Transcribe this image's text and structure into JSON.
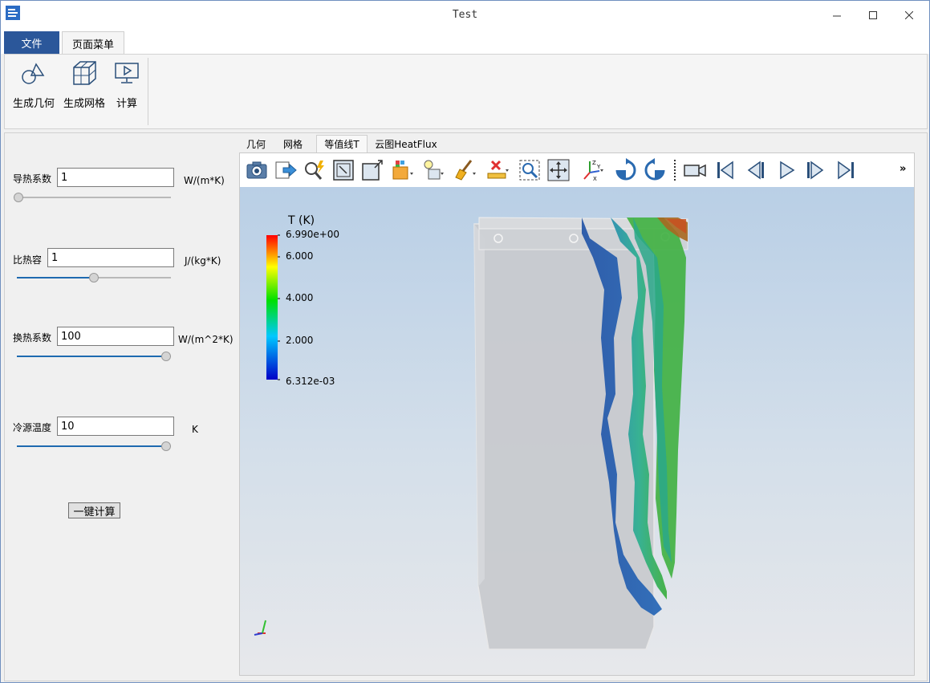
{
  "window": {
    "title": "Test"
  },
  "ribbon": {
    "tabs": [
      {
        "label": "文件"
      },
      {
        "label": "页面菜单"
      }
    ],
    "buttons": [
      {
        "label": "生成几何"
      },
      {
        "label": "生成网格"
      },
      {
        "label": "计算"
      }
    ]
  },
  "params": [
    {
      "label": "导热系数",
      "value": "1",
      "unit": "W/(m*K)",
      "slider_fraction": 0.0
    },
    {
      "label": "比热容",
      "value": "1",
      "unit": "J/(kg*K)",
      "slider_fraction": 0.5
    },
    {
      "label": "换热系数",
      "value": "100",
      "unit": "W/(m^2*K)",
      "slider_fraction": 1.0
    },
    {
      "label": "冷源温度",
      "value": "10",
      "unit": "K",
      "slider_fraction": 1.0
    }
  ],
  "calc_button": {
    "label": "一键计算"
  },
  "view_tabs": [
    {
      "label": "几何"
    },
    {
      "label": "网格"
    },
    {
      "label": "等值线T"
    },
    {
      "label": "云图HeatFlux"
    }
  ],
  "active_view_tab": 2,
  "toolbar": {
    "icons": [
      "camera-icon",
      "export-icon",
      "pick-icon",
      "box-in-icon",
      "box-out-icon",
      "display-icon",
      "light-icon",
      "brush-icon",
      "ruler-icon",
      "zoom-box-icon",
      "fit-view-icon",
      "axes-icon",
      "rotate-cw-icon",
      "rotate-ccw-icon",
      "video-camera-icon",
      "first-frame-icon",
      "prev-frame-icon",
      "play-icon",
      "next-frame-icon",
      "last-frame-icon"
    ],
    "more_label": "»"
  },
  "legend": {
    "title": "T (K)",
    "ticks": [
      "6.990e+00",
      "6.000",
      "4.000",
      "2.000",
      "6.312e-03"
    ],
    "colors": [
      "#0000c8",
      "#00c8ff",
      "#00e000",
      "#ffff00",
      "#ff0000"
    ]
  },
  "colors": {
    "accent": "#2b579a",
    "slider_fill": "#1e6ab0"
  }
}
